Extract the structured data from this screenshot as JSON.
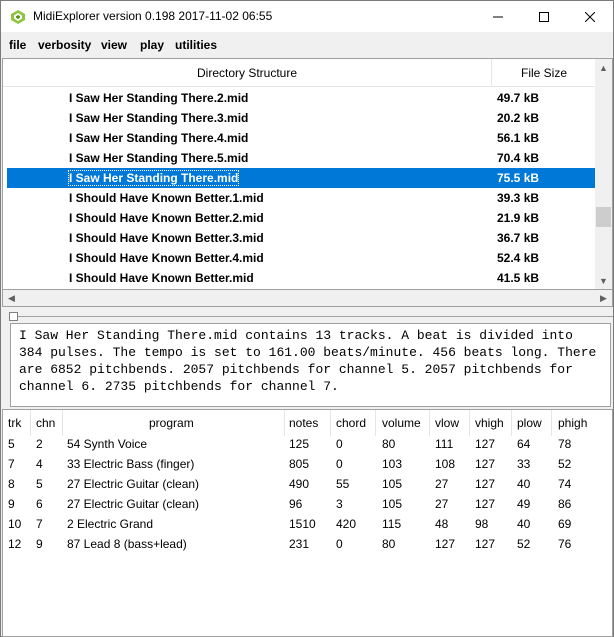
{
  "window": {
    "title": "MidiExplorer version 0.198 2017-11-02 06:55",
    "accent": "#0078d7"
  },
  "menu": [
    "file",
    "verbosity",
    "view",
    "play",
    "utilities"
  ],
  "tree": {
    "columns": [
      "Directory Structure",
      "File Size"
    ],
    "rows": [
      {
        "name": "I Saw Her Standing There.2.mid",
        "size": "49.7 kB"
      },
      {
        "name": "I Saw Her Standing There.3.mid",
        "size": "20.2 kB"
      },
      {
        "name": "I Saw Her Standing There.4.mid",
        "size": "56.1 kB"
      },
      {
        "name": "I Saw Her Standing There.5.mid",
        "size": "70.4 kB"
      },
      {
        "name": "I Saw Her Standing There.mid",
        "size": "75.5 kB",
        "selected": true
      },
      {
        "name": "I Should Have Known Better.1.mid",
        "size": "39.3 kB"
      },
      {
        "name": "I Should Have Known Better.2.mid",
        "size": "21.9 kB"
      },
      {
        "name": "I Should Have Known Better.3.mid",
        "size": "36.7 kB"
      },
      {
        "name": "I Should Have Known Better.4.mid",
        "size": "52.4 kB"
      },
      {
        "name": "I Should Have Known Better.mid",
        "size": "41.5 kB"
      }
    ]
  },
  "info_text": "I Saw Her Standing There.mid contains 13 tracks. A beat is divided into 384 pulses. The tempo is set to 161.00 beats/minute. 456 beats long. There are 6852 pitchbends. 2057 pitchbends for channel 5. 2057 pitchbends for channel 6. 2735 pitchbends for channel 7.",
  "tracks": {
    "columns": [
      "trk",
      "chn",
      "program",
      "notes",
      "chord",
      "volume",
      "vlow",
      "vhigh",
      "plow",
      "phigh"
    ],
    "rows": [
      [
        "5",
        "2",
        "54 Synth Voice",
        "125",
        "0",
        "80",
        "111",
        "127",
        "64",
        "78"
      ],
      [
        "7",
        "4",
        "33 Electric Bass (finger)",
        "805",
        "0",
        "103",
        "108",
        "127",
        "33",
        "52"
      ],
      [
        "8",
        "5",
        "27 Electric Guitar (clean)",
        "490",
        "55",
        "105",
        "27",
        "127",
        "40",
        "74"
      ],
      [
        "9",
        "6",
        "27 Electric Guitar (clean)",
        "96",
        "3",
        "105",
        "27",
        "127",
        "49",
        "86"
      ],
      [
        "10",
        "7",
        "2 Electric Grand",
        "1510",
        "420",
        "115",
        "48",
        "98",
        "40",
        "69"
      ],
      [
        "12",
        "9",
        "87 Lead 8 (bass+lead)",
        "231",
        "0",
        "80",
        "127",
        "127",
        "52",
        "76"
      ]
    ]
  }
}
